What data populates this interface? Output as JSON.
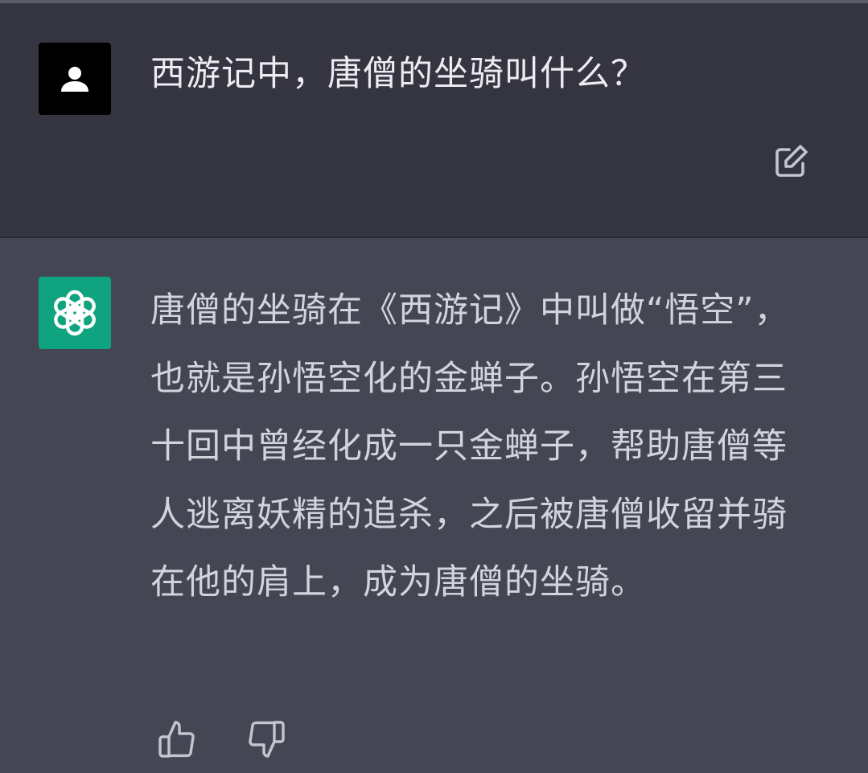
{
  "user_message": {
    "text": "西游记中，唐僧的坐骑叫什么？",
    "avatar_icon": "user-silhouette-icon",
    "edit_icon": "edit-icon"
  },
  "assistant_message": {
    "text": "唐僧的坐骑在《西游记》中叫做“悟空”，也就是孙悟空化的金蝉子。孙悟空在第三十回中曾经化成一只金蝉子，帮助唐僧等人逃离妖精的追杀，之后被唐僧收留并骑在他的肩上，成为唐僧的坐骑。",
    "avatar_icon": "openai-logo-icon",
    "feedback_icons": [
      "thumbs-up-icon",
      "thumbs-down-icon"
    ]
  },
  "colors": {
    "user_bg": "#343541",
    "assistant_bg": "#444654",
    "bot_avatar": "#10a37f",
    "text": "#d1d5db"
  }
}
